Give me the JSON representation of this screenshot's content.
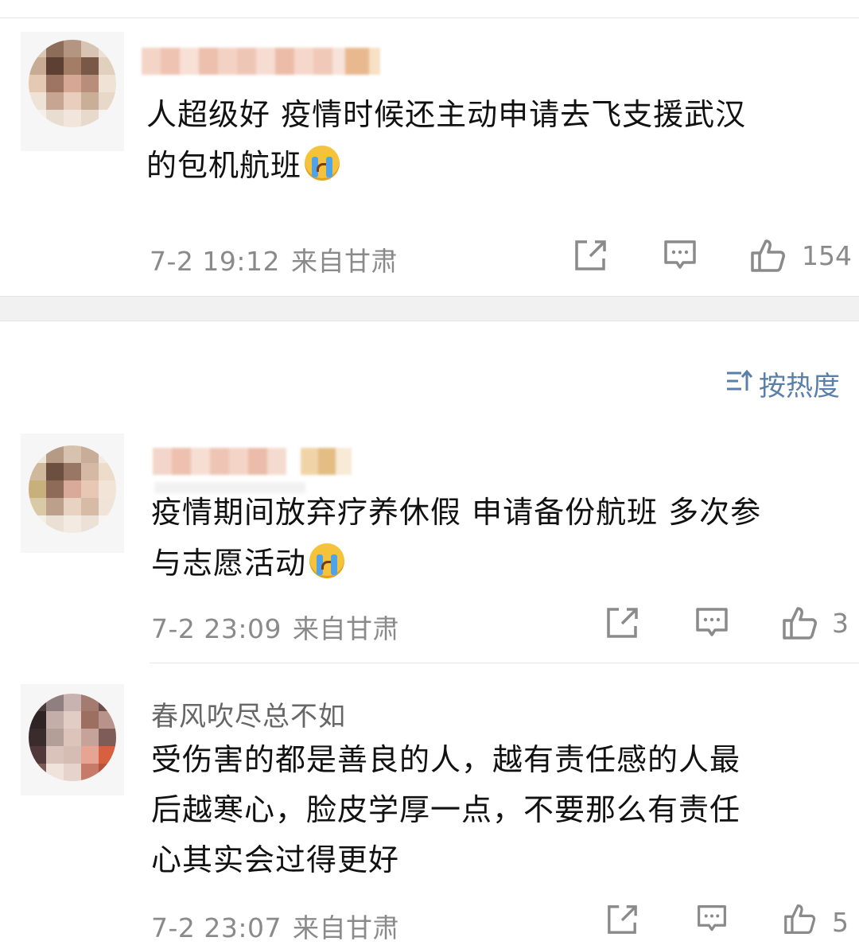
{
  "comments": [
    {
      "text_line1": "人超级好 疫情时候还主动申请去飞支援武汉",
      "text_line2": "的包机航班",
      "emoji": "crying-face",
      "time": "7-2 19:12",
      "source": "来自甘肃",
      "likes": "154"
    },
    {
      "text_line1": "疫情期间放弃疗养休假 申请备份航班 多次参",
      "text_line2": "与志愿活动",
      "emoji": "crying-face",
      "time": "7-2 23:09",
      "source": "来自甘肃",
      "likes": "3"
    }
  ],
  "sort": {
    "label": "按热度",
    "icon": "sort-icon"
  },
  "reply": {
    "username": "春风吹尽总不如",
    "text_line1": "受伤害的都是善良的人，越有责任感的人最",
    "text_line2": "后越寒心，脸皮学厚一点，不要那么有责任",
    "text_line3": "心其实会过得更好",
    "time": "7-2 23:07",
    "source": "来自甘肃",
    "likes": "5"
  },
  "icons": {
    "share": "share-icon",
    "comment": "comment-icon",
    "like": "thumbs-up-icon"
  },
  "colors": {
    "sort_text": "#5a7fa8",
    "meta_text": "#8a8a8a",
    "separator": "#f1f1f1"
  }
}
